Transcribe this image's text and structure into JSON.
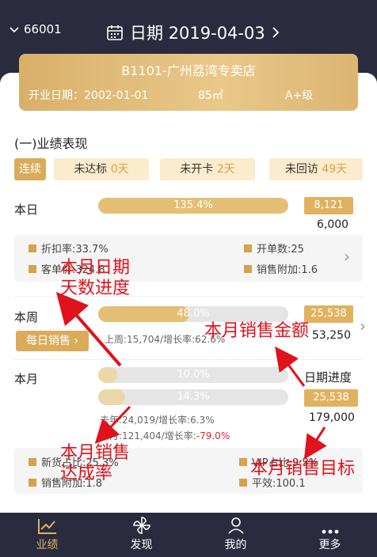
{
  "header": {
    "store_code": "66001",
    "date_label": "日期 2019-04-03"
  },
  "banner": {
    "store_name": "B1101-广州荔湾专卖店",
    "open_date": "开业日期：2002-01-01",
    "area": "85㎡",
    "level": "A+级"
  },
  "section_title": "(一)业绩表现",
  "pills": {
    "series": "连续",
    "not_reached": {
      "label": "未达标",
      "value": "0天"
    },
    "not_opened": {
      "label": "未开卡",
      "value": "2天"
    },
    "not_visited": {
      "label": "未回访",
      "value": "49天"
    }
  },
  "day": {
    "label": "本日",
    "progress_text": "135.4%",
    "progress": 1.354,
    "amount": "8,121",
    "target": "6,000",
    "stats": {
      "discount": "折扣率:33.7%",
      "orders": "开单数:25",
      "avg_price": "客单价:324.8",
      "attach": "销售附加:1.6"
    }
  },
  "week": {
    "label": "本周",
    "progress_text": "48.0%",
    "progress": 0.48,
    "amount": "25,538",
    "target": "53,250",
    "button": "每日销售",
    "last_week": "上周:15,704/增长率:62.6%"
  },
  "month": {
    "label": "本月",
    "day_progress_text": "10.0%",
    "day_progress": 0.1,
    "progress_text": "14.3%",
    "progress": 0.143,
    "day_progress_label": "日期进度",
    "amount": "25,538",
    "target": "179,000",
    "last_year": "去年:24,019/增长率:6.3%",
    "last_month_prefix": "上月:121,404/增长率:",
    "last_month_rate": "-79.0%",
    "stats": {
      "new_goods": "新货占比:25.3%",
      "vip": "VIP占比:9.5%",
      "attach": "销售附加:1.8",
      "avg": "平效:100.1"
    }
  },
  "annotations": {
    "a1_line1": "本月日期",
    "a1_line2": "天数进度",
    "a2": "本月销售金额",
    "a3_line1": "本月销售",
    "a3_line2": "达成率",
    "a4": "本月销售目标"
  },
  "tabs": [
    "业绩",
    "发现",
    "我的",
    "更多"
  ],
  "colors": {
    "accent": "#e0b25f",
    "annotation": "#e0121b",
    "header": "#2a2b3e"
  }
}
